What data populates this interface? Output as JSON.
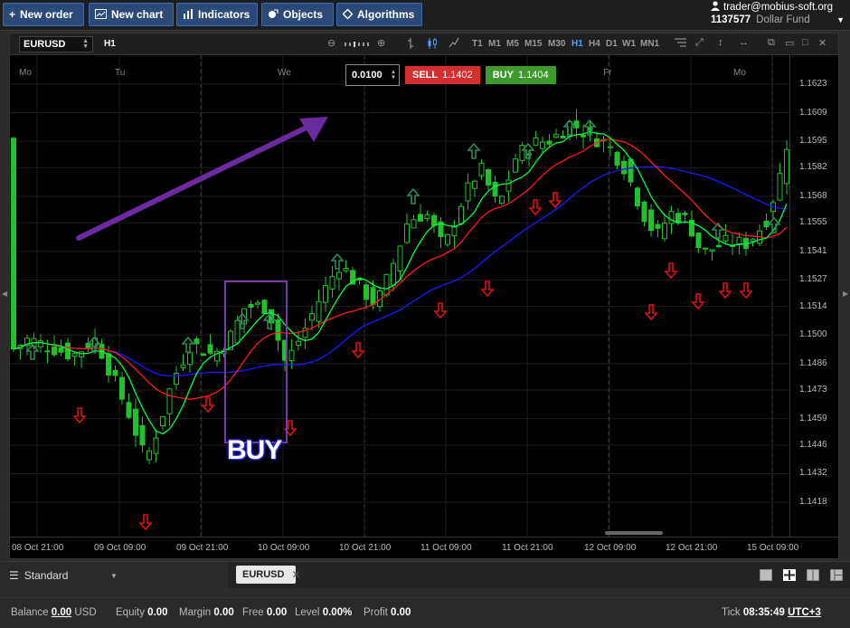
{
  "toolbar": {
    "new_order": "New order",
    "new_chart": "New chart",
    "indicators": "Indicators",
    "objects": "Objects",
    "algorithms": "Algorithms"
  },
  "account": {
    "email": "trader@mobius-soft.org",
    "number": "1137577",
    "fund": "Dollar Fund"
  },
  "chart": {
    "symbol": "EURUSD",
    "timeframe": "H1",
    "timeframes": [
      "T1",
      "M1",
      "M5",
      "M15",
      "M30",
      "H1",
      "H4",
      "D1",
      "W1",
      "MN1"
    ],
    "active_timeframe": "H1",
    "lot": "0.0100",
    "sell_label": "SELL",
    "sell_price": "1.1402",
    "buy_label": "BUY",
    "buy_price": "1.1404",
    "annotation": "BUY",
    "price_labels": [
      "1.1623",
      "1.1609",
      "1.1595",
      "1.1582",
      "1.1568",
      "1.1555",
      "1.1541",
      "1.1527",
      "1.1514",
      "1.1500",
      "1.1486",
      "1.1473",
      "1.1459",
      "1.1446",
      "1.1432",
      "1.1418"
    ],
    "time_labels": [
      "08 Oct 21:00",
      "09 Oct 09:00",
      "09 Oct 21:00",
      "10 Oct 09:00",
      "10 Oct 21:00",
      "11 Oct 09:00",
      "11 Oct 21:00",
      "12 Oct 09:00",
      "12 Oct 21:00",
      "15 Oct 09:00"
    ],
    "day_labels": [
      "Mo",
      "Tu",
      "We",
      "Fr",
      "Mo"
    ],
    "colors": {
      "bull": "#22c02a",
      "bear": "#22c02a",
      "ma_fast": "#00ff3c",
      "ma_mid": "#ff1a1a",
      "ma_slow": "#1a1aff",
      "up_arrow": "#2e8b57",
      "down_arrow": "#e01010",
      "trend_arrow": "#6a2aa0",
      "box": "#7a3aa8"
    }
  },
  "tabs": {
    "layout_name": "Standard",
    "chart_tab": "EURUSD"
  },
  "status": {
    "balance_label": "Balance",
    "balance": "0.00",
    "currency": "USD",
    "equity_label": "Equity",
    "equity": "0.00",
    "margin_label": "Margin",
    "margin": "0.00",
    "free_label": "Free",
    "free": "0.00",
    "level_label": "Level",
    "level": "0.00%",
    "profit_label": "Profit",
    "profit": "0.00",
    "tick_label": "Tick",
    "time": "08:35:49",
    "tz": "UTC+3"
  }
}
